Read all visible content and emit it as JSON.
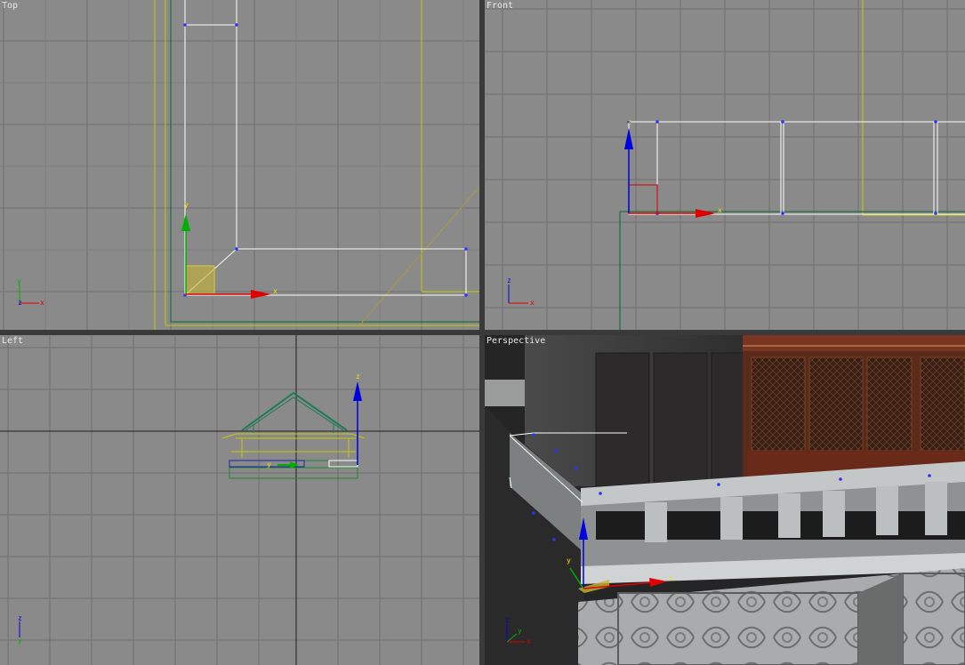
{
  "viewports": {
    "top": {
      "label": "Top"
    },
    "front": {
      "label": "Front"
    },
    "left": {
      "label": "Left"
    },
    "perspective": {
      "label": "Perspective"
    }
  },
  "axis_labels": {
    "x": "x",
    "y": "y",
    "z": "z"
  },
  "colors": {
    "viewport_bg": "#8a8a8a",
    "grid": "#6f6f6f",
    "active_border": "#e8d800",
    "gizmo_x": "#e00000",
    "gizmo_y": "#00b000",
    "gizmo_z": "#0000e0",
    "selection": "#ffffff",
    "guide_yellow": "#c8c800",
    "guide_green": "#006a2a"
  },
  "icons": [
    "axis-tripod-icon",
    "transform-gizmo-icon"
  ]
}
